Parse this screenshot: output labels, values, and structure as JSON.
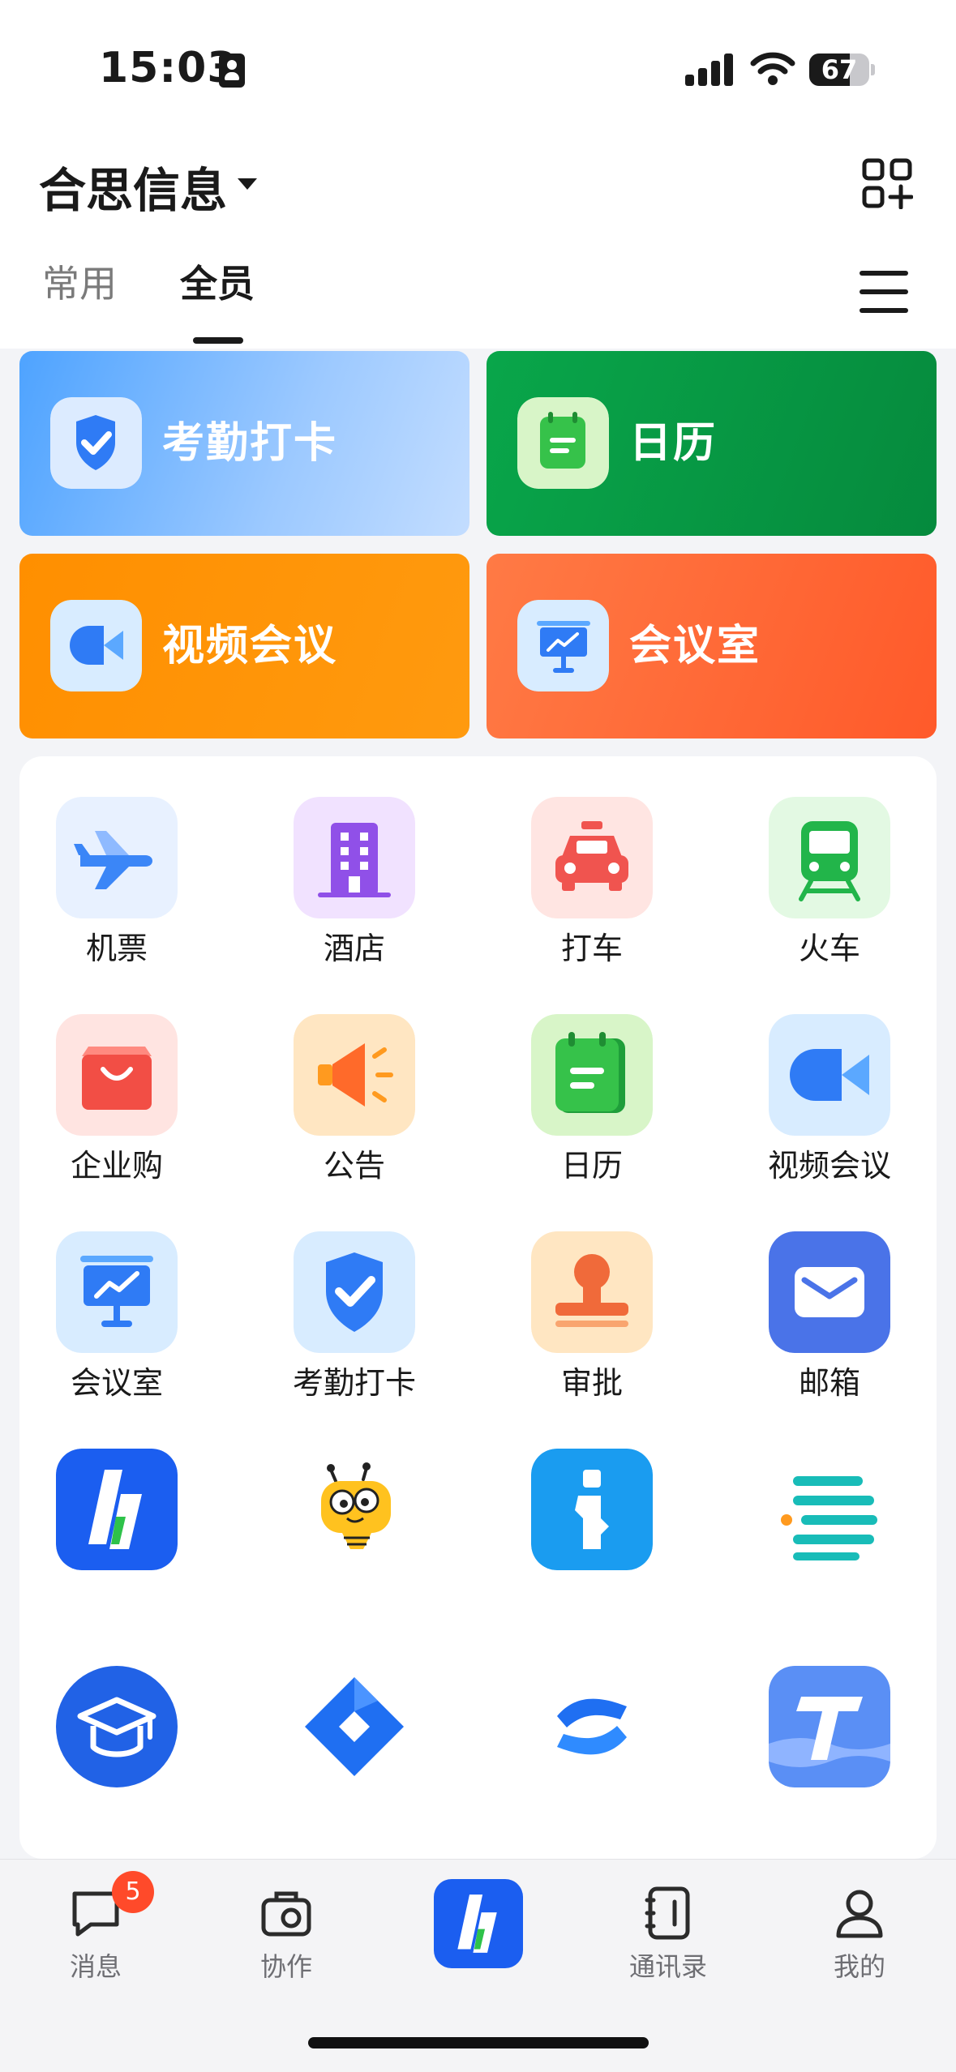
{
  "status_bar": {
    "time": "15:03",
    "battery_level": "67",
    "battery_fraction": 0.67,
    "icons": [
      "id-card-icon",
      "signal-icon",
      "wifi-icon",
      "battery-icon"
    ]
  },
  "header": {
    "org_name": "合思信息",
    "tabs": [
      {
        "label": "常用",
        "active": false
      },
      {
        "label": "全员",
        "active": true
      }
    ],
    "icons": [
      "dropdown-caret-icon",
      "add-app-icon",
      "menu-icon"
    ]
  },
  "quick_cards": [
    {
      "label": "考勤打卡",
      "icon": "attendance-check-icon",
      "color": "#4ea3ff"
    },
    {
      "label": "日历",
      "icon": "calendar-icon",
      "color": "#09a64a"
    },
    {
      "label": "视频会议",
      "icon": "video-camera-icon",
      "color": "#ff8f00"
    },
    {
      "label": "会议室",
      "icon": "meeting-room-icon",
      "color": "#ff6a35"
    }
  ],
  "apps": [
    {
      "label": "机票",
      "icon": "airplane-icon"
    },
    {
      "label": "酒店",
      "icon": "hotel-icon"
    },
    {
      "label": "打车",
      "icon": "taxi-icon"
    },
    {
      "label": "火车",
      "icon": "train-icon"
    },
    {
      "label": "企业购",
      "icon": "shopping-bag-icon"
    },
    {
      "label": "公告",
      "icon": "megaphone-icon"
    },
    {
      "label": "日历",
      "icon": "calendar-icon"
    },
    {
      "label": "视频会议",
      "icon": "video-camera-icon"
    },
    {
      "label": "会议室",
      "icon": "meeting-room-icon"
    },
    {
      "label": "考勤打卡",
      "icon": "attendance-check-icon"
    },
    {
      "label": "审批",
      "icon": "approval-stamp-icon"
    },
    {
      "label": "邮箱",
      "icon": "mail-icon"
    },
    {
      "label": "",
      "icon": "hosecloud-logo-icon"
    },
    {
      "label": "",
      "icon": "bee-mascot-icon"
    },
    {
      "label": "",
      "icon": "info-app-icon"
    },
    {
      "label": "",
      "icon": "text-lines-icon"
    },
    {
      "label": "",
      "icon": "graduation-cap-icon"
    },
    {
      "label": "",
      "icon": "jira-icon"
    },
    {
      "label": "",
      "icon": "confluence-icon"
    },
    {
      "label": "",
      "icon": "t-app-icon"
    }
  ],
  "bottom_nav": [
    {
      "label": "消息",
      "icon": "message-icon",
      "badge": "5"
    },
    {
      "label": "协作",
      "icon": "collaborate-icon"
    },
    {
      "label": "",
      "icon": "hosecloud-logo-icon"
    },
    {
      "label": "通讯录",
      "icon": "contacts-icon"
    },
    {
      "label": "我的",
      "icon": "profile-icon"
    }
  ],
  "colors": {
    "accent_blue": "#2f7bf5",
    "badge_red": "#ff4a2a",
    "text_primary": "#1a1a1a",
    "text_secondary": "#7a7a7a"
  }
}
